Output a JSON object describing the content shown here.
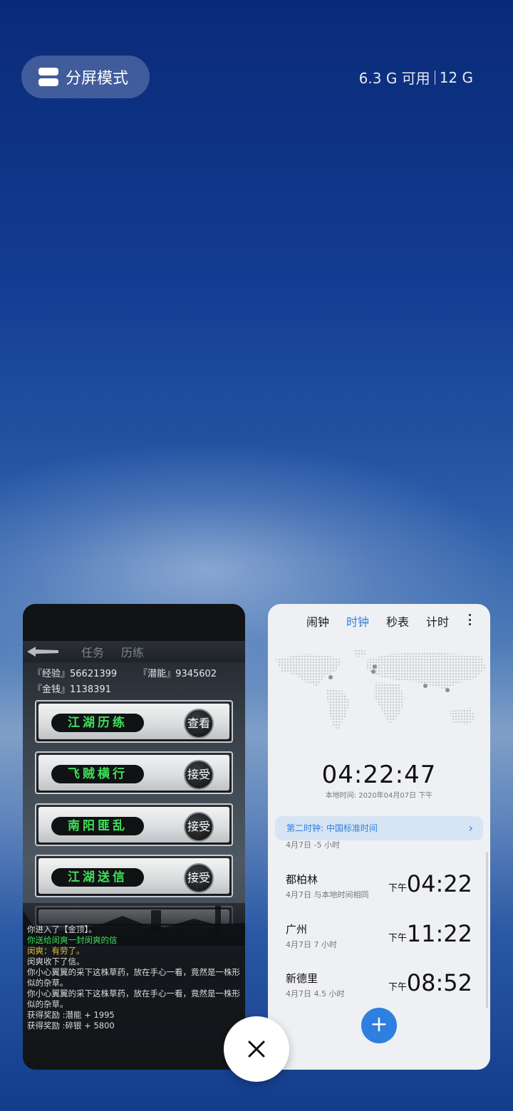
{
  "top": {
    "split_label": "分屏模式",
    "mem_available": "6.3 G 可用",
    "mem_total": "12 G"
  },
  "game": {
    "tabs": [
      "任务",
      "历练"
    ],
    "stats": {
      "exp": "『经验』56621399",
      "potential": "『潜能』9345602",
      "money": "『金钱』1138391"
    },
    "tasks": [
      {
        "name": "江湖历练",
        "action": "查看"
      },
      {
        "name": "飞贼横行",
        "action": "接受"
      },
      {
        "name": "南阳匪乱",
        "action": "接受"
      },
      {
        "name": "江湖送信",
        "action": "接受"
      }
    ],
    "log": [
      "你进入了【金顶】。",
      "你送给闵爽一封闵爽的信",
      "闵爽：有劳了。",
      "闵爽收下了信。",
      "你小心翼翼的采下这株草药，放在手心一看，竟然是一株形似的杂草。",
      "你小心翼翼的采下这株草药，放在手心一看，竟然是一株形似的杂草。",
      "获得奖励 :潜能 + 1995",
      "获得奖励 :碎银 + 5800"
    ]
  },
  "clock": {
    "tabs": [
      {
        "label": "闹钟",
        "active": false
      },
      {
        "label": "时钟",
        "active": true
      },
      {
        "label": "秒表",
        "active": false
      },
      {
        "label": "计时",
        "active": false
      }
    ],
    "big_time": "04:22:47",
    "local_time": "本地时间: 2020年04月07日  下午",
    "second_clock": "第二时钟: 中国标准时间",
    "partial_row": {
      "sub": "4月7日 -5 小时"
    },
    "cities": [
      {
        "name": "都柏林",
        "sub": "4月7日 与本地时间相同",
        "ampm": "下午",
        "time": "04:22"
      },
      {
        "name": "广州",
        "sub": "4月7日 7 小时",
        "ampm": "下午",
        "time": "11:22"
      },
      {
        "name": "新德里",
        "sub": "4月7日 4.5 小时",
        "ampm": "下午",
        "time": "08:52"
      }
    ],
    "accent": "#2f7fe0"
  },
  "icons": {
    "split": "split-screen-icon",
    "more": "more-vert-icon",
    "add": "plus-icon",
    "close": "close-icon",
    "chevron": "chevron-right-icon",
    "back": "back-arrow-icon"
  }
}
